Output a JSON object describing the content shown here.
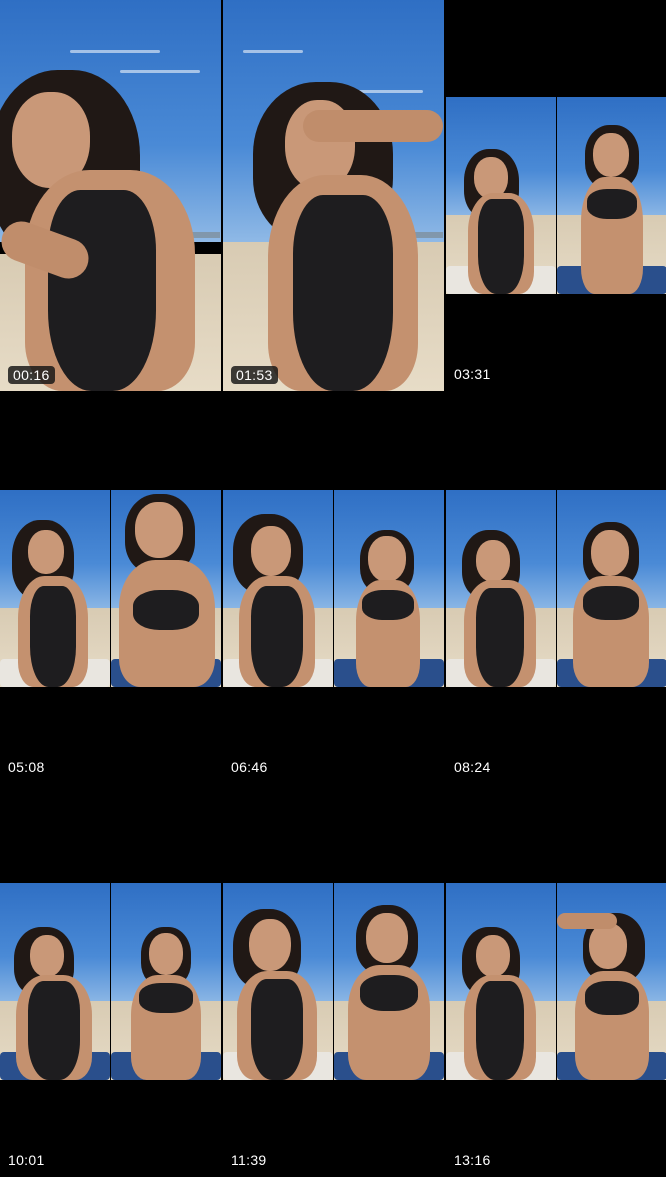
{
  "gallery": {
    "tiles": [
      {
        "timestamp": "00:16",
        "layout": "full"
      },
      {
        "timestamp": "01:53",
        "layout": "full"
      },
      {
        "timestamp": "03:31",
        "layout": "split"
      },
      {
        "timestamp": "05:08",
        "layout": "split"
      },
      {
        "timestamp": "06:46",
        "layout": "split"
      },
      {
        "timestamp": "08:24",
        "layout": "split"
      },
      {
        "timestamp": "10:01",
        "layout": "split"
      },
      {
        "timestamp": "11:39",
        "layout": "split"
      },
      {
        "timestamp": "13:16",
        "layout": "split"
      }
    ]
  },
  "colors": {
    "background": "#000000",
    "sky": "#3b7ccc",
    "sand": "#e2d6bf",
    "towel": "#2a4f8c",
    "swimsuit": "#1e1d1f"
  }
}
